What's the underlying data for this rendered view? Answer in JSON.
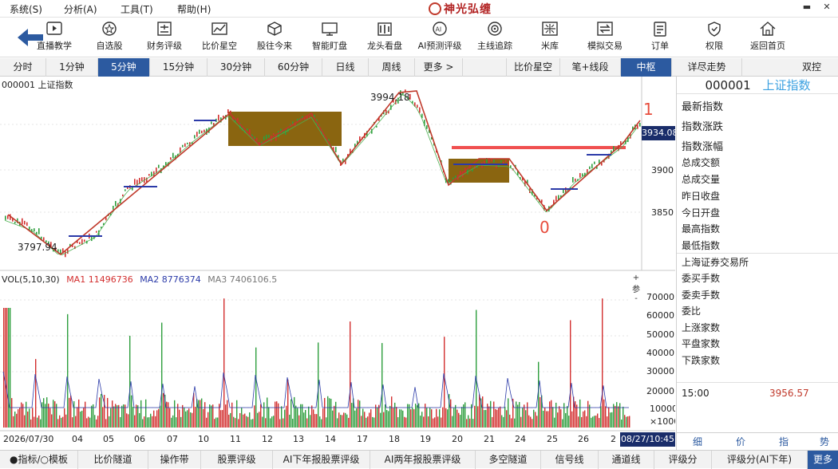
{
  "menu": [
    "系统(S)",
    "分析(A)",
    "工具(T)",
    "帮助(H)"
  ],
  "app_logo_text": "神光弘缠",
  "toolbar": {
    "tools": [
      {
        "label": "直播教学",
        "icon": "play-icon"
      },
      {
        "label": "自选股",
        "icon": "star-list-icon"
      },
      {
        "label": "财务评级",
        "icon": "finance-icon"
      },
      {
        "label": "比价星空",
        "icon": "compare-icon"
      },
      {
        "label": "股往今来",
        "icon": "cube-icon"
      },
      {
        "label": "智能盯盘",
        "icon": "monitor-icon"
      },
      {
        "label": "龙头看盘",
        "icon": "dragon-icon"
      },
      {
        "label": "AI预测评级",
        "icon": "ai-icon"
      },
      {
        "label": "主线追踪",
        "icon": "target-icon"
      },
      {
        "label": "米库",
        "icon": "rice-icon"
      },
      {
        "label": "模拟交易",
        "icon": "exchange-icon"
      },
      {
        "label": "订单",
        "icon": "order-icon"
      },
      {
        "label": "权限",
        "icon": "shield-icon"
      },
      {
        "label": "返回首页",
        "icon": "home-icon"
      }
    ]
  },
  "period_tabs": [
    "分时",
    "1分钟",
    "5分钟",
    "15分钟",
    "30分钟",
    "60分钟",
    "日线",
    "周线",
    "更多 >"
  ],
  "tool_tabs": [
    "比价星空",
    "笔+线段",
    "中枢",
    "详尽走势",
    "双控"
  ],
  "active_period": "5分钟",
  "active_tool": "中枢",
  "chart": {
    "title": "000001 上证指数",
    "current_price": "3934.08",
    "high_label": "3994.18",
    "low_label": "3797.94",
    "wave_labels": [
      "0",
      "1"
    ],
    "y_ticks": [
      "3900",
      "3850"
    ],
    "volume": {
      "legend_vol": "VOL(5,10,30)",
      "legend_ma1": "MA1 11496736",
      "legend_ma2": "MA2 8776374",
      "legend_ma3": "MA3 7406106.5",
      "y_ticks": [
        "70000",
        "60000",
        "50000",
        "40000",
        "30000",
        "20000",
        "10000",
        "×1000"
      ]
    },
    "x_labels": [
      "2026/07/30",
      "04",
      "05",
      "06",
      "07",
      "10",
      "11",
      "12",
      "13",
      "14",
      "17",
      "18",
      "19",
      "20",
      "21",
      "24",
      "25",
      "26",
      "2"
    ],
    "time_badge": "08/27/10:45",
    "side_buttons": [
      "+",
      "参",
      "-"
    ],
    "colors": {
      "up": "#d32f2f",
      "down": "#2e9e3e",
      "zhongshu": "#8a6510",
      "resistance": "#f05050",
      "ma2": "#2b3aa8"
    }
  },
  "side_panel": {
    "code": "000001",
    "name": "上证指数",
    "rows_big": [
      "最新指数",
      "指数涨跌",
      "指数涨幅"
    ],
    "rows": [
      "总成交额",
      "总成交量",
      "昨日收盘",
      "今日开盘",
      "最高指数",
      "最低指数"
    ],
    "rows2": [
      "上海证券交易所",
      "委买手数",
      "委卖手数",
      "委比",
      "上涨家数",
      "平盘家数",
      "下跌家数"
    ],
    "time": "15:00",
    "price": "3956.57",
    "tabs": [
      "细",
      "价",
      "指",
      "势"
    ]
  },
  "bottom_tabs": [
    "●指标/○模板",
    "比价隧道",
    "操作带",
    "股票评级",
    "AI下年报股票评级",
    "AI两年报股票评级",
    "多空隧道",
    "信号线",
    "通道线",
    "评级分",
    "评级分(AI下年)",
    "更多"
  ]
}
